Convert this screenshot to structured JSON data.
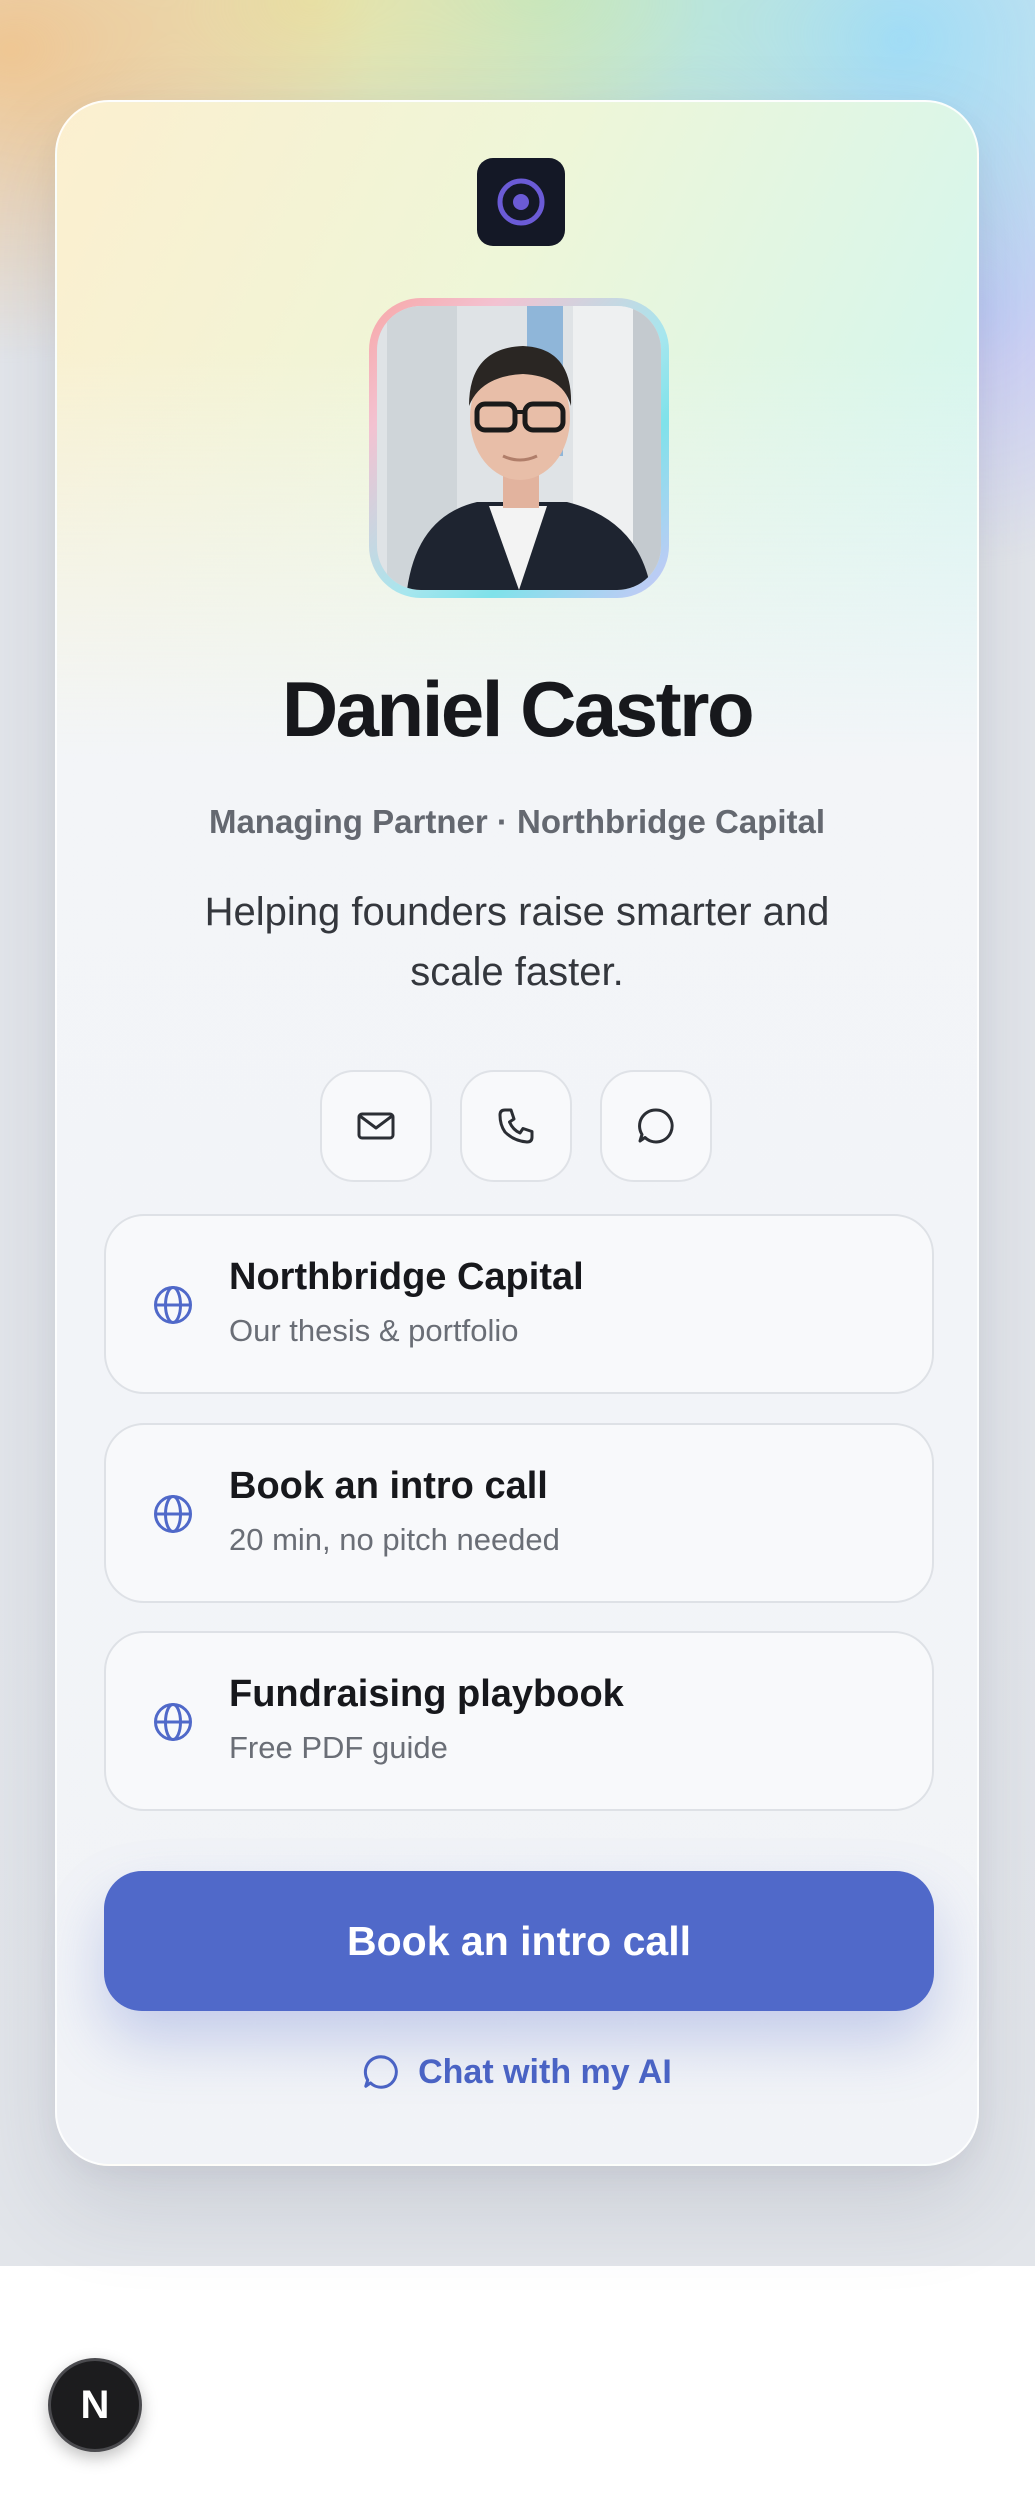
{
  "brand": {
    "logo_icon": "target-ring-icon",
    "logo_bg": "#141826",
    "logo_accent": "#6b5bd6"
  },
  "profile": {
    "name": "Daniel Castro",
    "subtitle": "Managing Partner · Northbridge Capital",
    "tagline": "Helping founders raise smarter and scale faster."
  },
  "contact_icons": [
    {
      "icon": "mail-icon"
    },
    {
      "icon": "phone-icon"
    },
    {
      "icon": "chat-bubble-icon"
    }
  ],
  "links": [
    {
      "title": "Northbridge Capital",
      "description": "Our thesis & portfolio",
      "icon": "globe-icon"
    },
    {
      "title": "Book an intro call",
      "description": "20 min, no pitch needed",
      "icon": "globe-icon"
    },
    {
      "title": "Fundraising playbook",
      "description": "Free PDF guide",
      "icon": "globe-icon"
    }
  ],
  "cta": {
    "label": "Book an intro call",
    "color": "#5069c9"
  },
  "chat": {
    "label": "Chat with my AI",
    "icon": "chat-bubble-icon",
    "color": "#4a63c4"
  },
  "fab": {
    "label": "N"
  }
}
